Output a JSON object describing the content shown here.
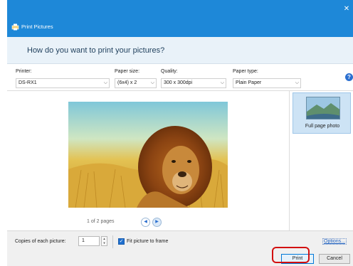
{
  "window": {
    "title": "Print Pictures",
    "close_glyph": "✕"
  },
  "header": {
    "question": "How do you want to print your pictures?"
  },
  "options": {
    "printer": {
      "label": "Printer:",
      "value": "DS-RX1"
    },
    "paper_size": {
      "label": "Paper size:",
      "value": "(6x4) x 2"
    },
    "quality": {
      "label": "Quality:",
      "value": "300 x 300dpi"
    },
    "paper_type": {
      "label": "Paper type:",
      "value": "Plain Paper"
    },
    "help_glyph": "?"
  },
  "preview": {
    "pager_text": "1 of 2 pages",
    "prev_glyph": "◀",
    "next_glyph": "▶"
  },
  "layouts": {
    "selected_label": "Full page photo"
  },
  "bottom": {
    "copies_label": "Copies of each picture:",
    "copies_value": "1",
    "fit_label": "Fit picture to frame",
    "fit_checked": true,
    "options_link": "Options..."
  },
  "buttons": {
    "print": "Print",
    "cancel": "Cancel"
  },
  "colors": {
    "titlebar": "#1e88d8",
    "header_bg": "#e9f2f9",
    "accent": "#1f6fce",
    "highlight": "#d21010"
  }
}
